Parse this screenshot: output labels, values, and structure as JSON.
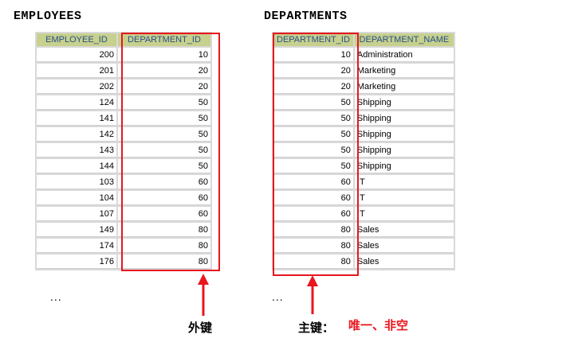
{
  "employees": {
    "title": "EMPLOYEES",
    "columns": [
      "EMPLOYEE_ID",
      "DEPARTMENT_ID"
    ],
    "rows": [
      [
        "200",
        "10"
      ],
      [
        "201",
        "20"
      ],
      [
        "202",
        "20"
      ],
      [
        "124",
        "50"
      ],
      [
        "141",
        "50"
      ],
      [
        "142",
        "50"
      ],
      [
        "143",
        "50"
      ],
      [
        "144",
        "50"
      ],
      [
        "103",
        "60"
      ],
      [
        "104",
        "60"
      ],
      [
        "107",
        "60"
      ],
      [
        "149",
        "80"
      ],
      [
        "174",
        "80"
      ],
      [
        "176",
        "80"
      ]
    ],
    "more": "..."
  },
  "departments": {
    "title": "DEPARTMENTS",
    "columns": [
      "DEPARTMENT_ID",
      "DEPARTMENT_NAME"
    ],
    "rows": [
      [
        "10",
        "Administration"
      ],
      [
        "20",
        "Marketing"
      ],
      [
        "20",
        "Marketing"
      ],
      [
        "50",
        "Shipping"
      ],
      [
        "50",
        "Shipping"
      ],
      [
        "50",
        "Shipping"
      ],
      [
        "50",
        "Shipping"
      ],
      [
        "50",
        "Shipping"
      ],
      [
        "60",
        "IT"
      ],
      [
        "60",
        "IT"
      ],
      [
        "60",
        "IT"
      ],
      [
        "80",
        "Sales"
      ],
      [
        "80",
        "Sales"
      ],
      [
        "80",
        "Sales"
      ]
    ],
    "more": "..."
  },
  "annotations": {
    "foreign_key_label": "外键",
    "primary_key_label": "主键：",
    "primary_key_note": "唯一、非空",
    "highlight_color": "#e8161d"
  }
}
